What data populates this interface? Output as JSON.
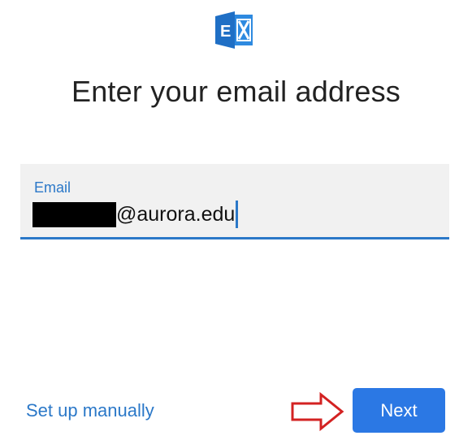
{
  "logo": {
    "icon": "exchange-logo-icon",
    "color": "#1f6fc5"
  },
  "title": "Enter your email address",
  "email_field": {
    "label": "Email",
    "value_visible": "@aurora.edu",
    "accent_color": "#2b78c8"
  },
  "actions": {
    "manual_label": "Set up manually",
    "next_label": "Next",
    "annotation_icon": "red-arrow-icon"
  }
}
